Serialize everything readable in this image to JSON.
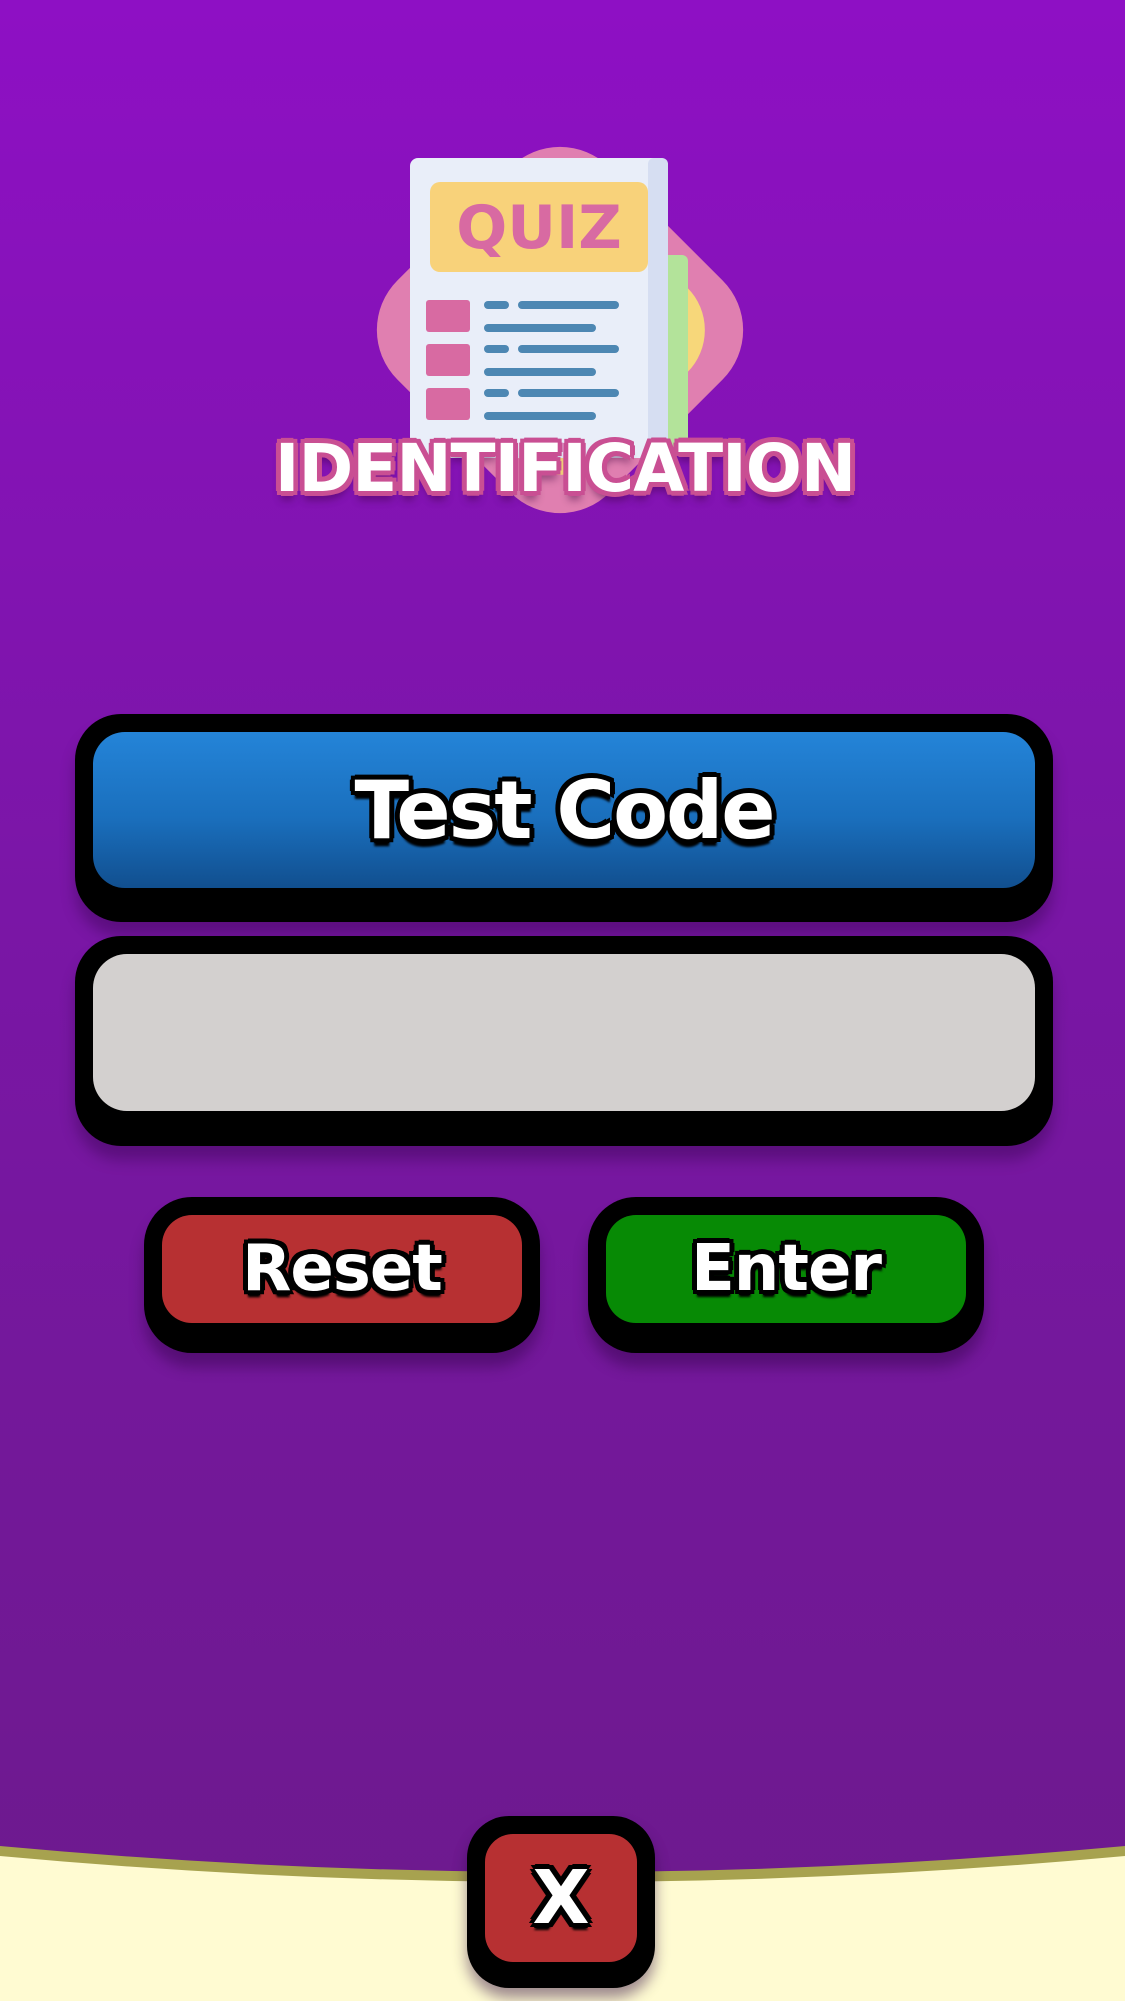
{
  "logo": {
    "badge_text": "QUIZ",
    "word": "IDENTIFICATION"
  },
  "title_panel": {
    "label": "Test Code"
  },
  "code_input": {
    "value": "",
    "placeholder": ""
  },
  "buttons": {
    "reset_label": "Reset",
    "enter_label": "Enter",
    "close_label": "X"
  },
  "colors": {
    "background_top": "#8e10c4",
    "background_bottom": "#6c1a8c",
    "title_blue": "#1a6fbd",
    "input_gray": "#d3d0cf",
    "reset_red": "#b73032",
    "enter_green": "#078a05",
    "bottom_cream": "#fffbd2",
    "bottom_edge_olive": "#a7a24f"
  }
}
